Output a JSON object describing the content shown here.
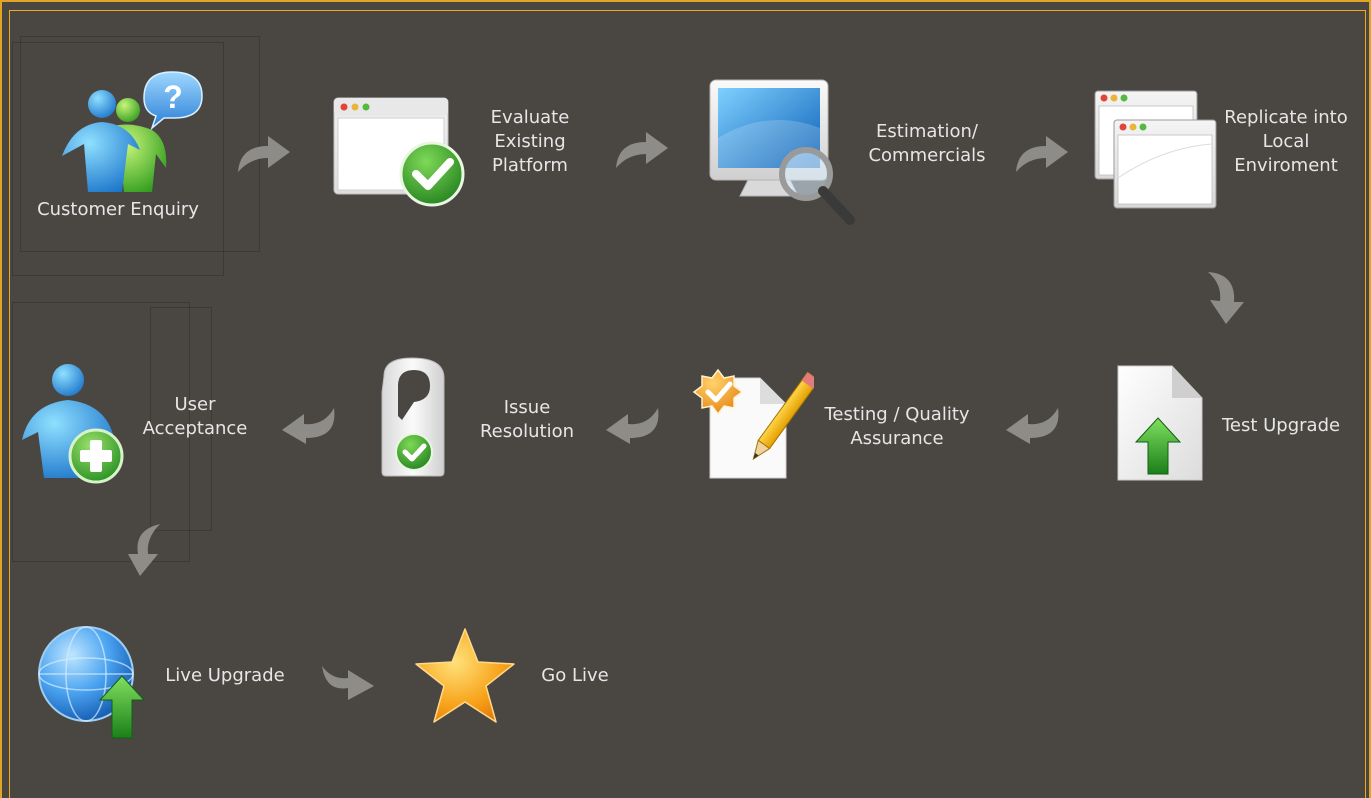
{
  "steps": {
    "customer_enquiry": "Customer Enquiry",
    "evaluate": "Evaluate\nExisting\nPlatform",
    "estimation": "Estimation/\nCommercials",
    "replicate": "Replicate into\nLocal\nEnviroment",
    "test_upgrade": "Test Upgrade",
    "testing_qa": "Testing / Quality\nAssurance",
    "issue_resolution": "Issue\nResolution",
    "user_acceptance": "User\nAcceptance",
    "live_upgrade": "Live Upgrade",
    "go_live": "Go Live"
  },
  "colors": {
    "background": "#4a4743",
    "border": "#e1a523",
    "text": "#e6e6e6",
    "arrow": "#8e8c89"
  },
  "icons": {
    "customer_enquiry": "users-question-icon",
    "evaluate": "browser-check-icon",
    "estimation": "monitor-magnifier-icon",
    "replicate": "multiple-windows-icon",
    "test_upgrade": "document-upload-icon",
    "testing_qa": "document-pencil-check-icon",
    "issue_resolution": "door-hanger-check-icon",
    "user_acceptance": "user-add-icon",
    "live_upgrade": "globe-upload-icon",
    "go_live": "star-icon"
  }
}
